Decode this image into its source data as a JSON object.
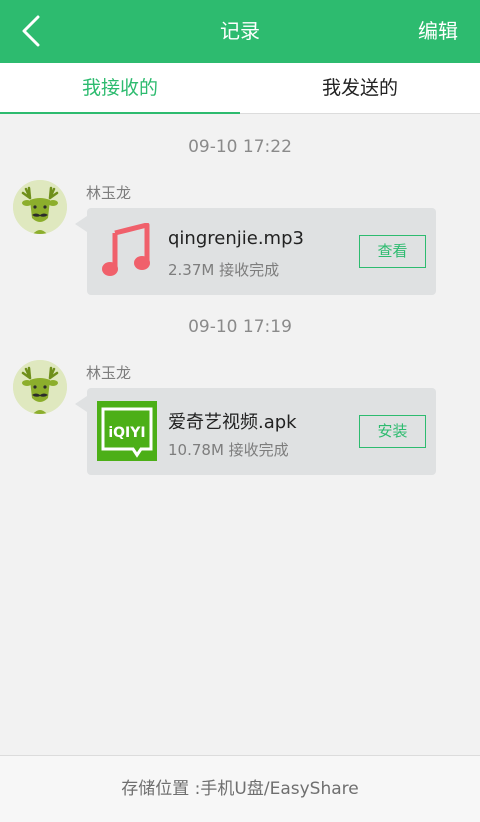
{
  "header": {
    "back_icon": "chevron-left-icon",
    "title": "记录",
    "edit_label": "编辑",
    "color": "#2dbb6f"
  },
  "tabs": [
    {
      "label": "我接收的",
      "active": true
    },
    {
      "label": "我发送的",
      "active": false
    }
  ],
  "records": [
    {
      "timestamp": "09-10 17:22",
      "sender": "林玉龙",
      "avatar_icon": "deer-avatar-icon",
      "file_icon": "music-note-icon",
      "file_name": "qingrenjie.mp3",
      "status": "2.37M 接收完成",
      "action": "查看"
    },
    {
      "timestamp": "09-10 17:19",
      "sender": "林玉龙",
      "avatar_icon": "deer-avatar-icon",
      "file_icon": "iqiyi-app-icon",
      "app_icon_text": "iQIYI",
      "file_name": "爱奇艺视频.apk",
      "status": "10.78M 接收完成",
      "action": "安装"
    }
  ],
  "footer": {
    "storage_text": "存储位置 :手机U盘/EasyShare"
  }
}
